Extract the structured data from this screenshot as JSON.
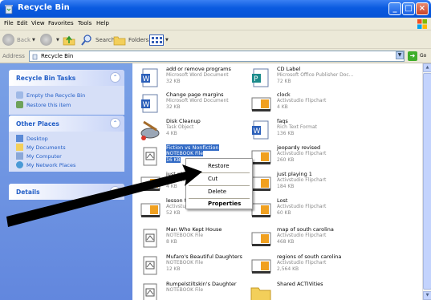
{
  "window": {
    "title": "Recycle Bin"
  },
  "menu": [
    "File",
    "Edit",
    "View",
    "Favorites",
    "Tools",
    "Help"
  ],
  "toolbar": {
    "back": "Back",
    "search": "Search",
    "folders": "Folders"
  },
  "address": {
    "label": "Address",
    "value": "Recycle Bin",
    "go": "Go"
  },
  "left_pane": {
    "tasks": {
      "title": "Recycle Bin Tasks",
      "items": [
        "Empty the Recycle Bin",
        "Restore this item"
      ]
    },
    "places": {
      "title": "Other Places",
      "items": [
        "Desktop",
        "My Documents",
        "My Computer",
        "My Network Places"
      ]
    },
    "details": {
      "title": "Details"
    }
  },
  "files": [
    {
      "name": "add or remove programs",
      "type": "Microsoft Word Document",
      "size": "32 KB",
      "icon": "word-doc-icon"
    },
    {
      "name": "CD Label",
      "type": "Microsoft Office Publisher Doc...",
      "size": "72 KB",
      "icon": "publisher-doc-icon"
    },
    {
      "name": "Change page margins",
      "type": "Microsoft Word Document",
      "size": "32 KB",
      "icon": "word-doc-icon"
    },
    {
      "name": "clock",
      "type": "Activstudio Flipchart",
      "size": "4 KB",
      "icon": "flipchart-icon"
    },
    {
      "name": "Disk Cleanup",
      "type": "Task Object",
      "size": "4 KB",
      "icon": "disk-cleanup-icon"
    },
    {
      "name": "faqs",
      "type": "Rich Text Format",
      "size": "136 KB",
      "icon": "rtf-doc-icon"
    },
    {
      "name": "Fiction vs Nonfiction",
      "type": "NOTEBOOK File",
      "size": "16 KB",
      "icon": "notebook-file-icon",
      "selected": true
    },
    {
      "name": "jeopardy revised",
      "type": "Activstudio Flipchart",
      "size": "260 KB",
      "icon": "flipchart-icon"
    },
    {
      "name": "just playing",
      "type": "Activstudio Fl",
      "size": "4 KB",
      "icon": "flipchart-icon"
    },
    {
      "name": "just playing 1",
      "type": "Activstudio Flipchart",
      "size": "184 KB",
      "icon": "flipchart-icon"
    },
    {
      "name": "lesson templat",
      "type": "Activstudio Flipchart",
      "size": "52 KB",
      "icon": "flipchart-icon"
    },
    {
      "name": "Lost",
      "type": "Activstudio Flipchart",
      "size": "60 KB",
      "icon": "flipchart-icon"
    },
    {
      "name": "Man Who Kept House",
      "type": "NOTEBOOK File",
      "size": "8 KB",
      "icon": "notebook-file-icon"
    },
    {
      "name": "map of south carolina",
      "type": "Activstudio Flipchart",
      "size": "468 KB",
      "icon": "flipchart-icon"
    },
    {
      "name": "Mufaro's Beautiful Daughters",
      "type": "NOTEBOOK File",
      "size": "12 KB",
      "icon": "notebook-file-icon"
    },
    {
      "name": "regions of south carolina",
      "type": "Activstudio Flipchart",
      "size": "2,564 KB",
      "icon": "flipchart-icon"
    },
    {
      "name": "Rumpelstiltskin's Daughter",
      "type": "NOTEBOOK File",
      "size": "",
      "icon": "notebook-file-icon"
    },
    {
      "name": "Shared ACTIVities",
      "type": "",
      "size": "",
      "icon": "folder-icon"
    }
  ],
  "context_menu": [
    "Restore",
    "Cut",
    "Delete",
    "Properties"
  ],
  "colors": {
    "title_bar": "#0a5ae0",
    "left_pane": "#6d94e2",
    "selection": "#316ac5"
  }
}
